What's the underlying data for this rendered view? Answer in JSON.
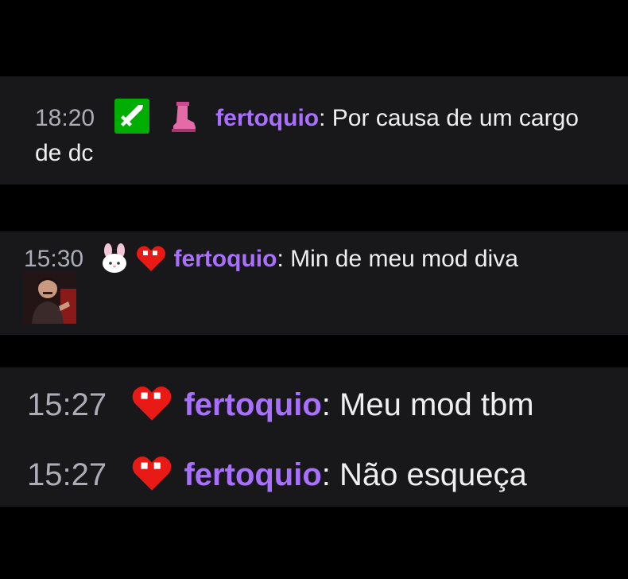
{
  "chat": {
    "messages": [
      {
        "time": "18:20",
        "username": "fertoquio",
        "colon": ":",
        "text_line1": "Por causa de um cargo",
        "text_line2": "de dc",
        "badges": [
          "moderator-sword-badge",
          "pink-boot-badge"
        ]
      },
      {
        "time": "15:30",
        "username": "fertoquio",
        "colon": ":",
        "text": "Min de meu mod diva",
        "badges": [
          "my-melody-badge",
          "pixel-heart-badge"
        ],
        "emote": "person-photo-emote"
      },
      {
        "time": "15:27",
        "username": "fertoquio",
        "colon": ":",
        "text": "Meu mod tbm",
        "badges": [
          "pixel-heart-badge"
        ]
      },
      {
        "time": "15:27",
        "username": "fertoquio",
        "colon": ":",
        "text": "Não esqueça",
        "badges": [
          "pixel-heart-badge"
        ]
      }
    ]
  },
  "colors": {
    "background": "#000000",
    "panel": "#18181b",
    "username": "#a970ff",
    "timestamp": "#adadb8",
    "text": "#efeff1",
    "mod_badge": "#00ad03",
    "heart_badge": "#e91916"
  }
}
